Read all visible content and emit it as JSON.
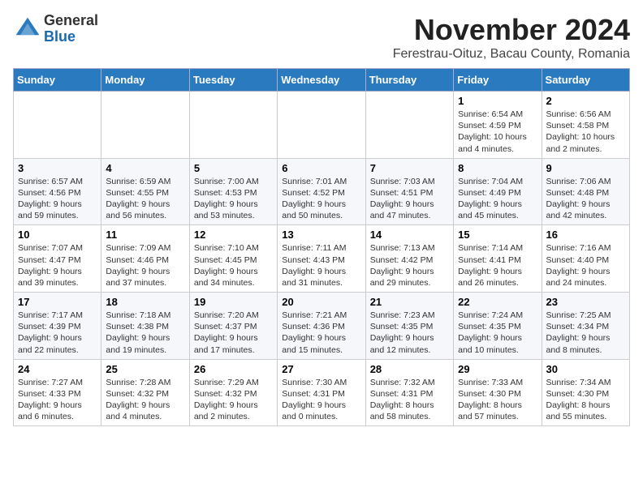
{
  "header": {
    "logo_general": "General",
    "logo_blue": "Blue",
    "month_title": "November 2024",
    "subtitle": "Ferestrau-Oituz, Bacau County, Romania"
  },
  "days_of_week": [
    "Sunday",
    "Monday",
    "Tuesday",
    "Wednesday",
    "Thursday",
    "Friday",
    "Saturday"
  ],
  "weeks": [
    [
      {
        "day": "",
        "info": ""
      },
      {
        "day": "",
        "info": ""
      },
      {
        "day": "",
        "info": ""
      },
      {
        "day": "",
        "info": ""
      },
      {
        "day": "",
        "info": ""
      },
      {
        "day": "1",
        "info": "Sunrise: 6:54 AM\nSunset: 4:59 PM\nDaylight: 10 hours and 4 minutes."
      },
      {
        "day": "2",
        "info": "Sunrise: 6:56 AM\nSunset: 4:58 PM\nDaylight: 10 hours and 2 minutes."
      }
    ],
    [
      {
        "day": "3",
        "info": "Sunrise: 6:57 AM\nSunset: 4:56 PM\nDaylight: 9 hours and 59 minutes."
      },
      {
        "day": "4",
        "info": "Sunrise: 6:59 AM\nSunset: 4:55 PM\nDaylight: 9 hours and 56 minutes."
      },
      {
        "day": "5",
        "info": "Sunrise: 7:00 AM\nSunset: 4:53 PM\nDaylight: 9 hours and 53 minutes."
      },
      {
        "day": "6",
        "info": "Sunrise: 7:01 AM\nSunset: 4:52 PM\nDaylight: 9 hours and 50 minutes."
      },
      {
        "day": "7",
        "info": "Sunrise: 7:03 AM\nSunset: 4:51 PM\nDaylight: 9 hours and 47 minutes."
      },
      {
        "day": "8",
        "info": "Sunrise: 7:04 AM\nSunset: 4:49 PM\nDaylight: 9 hours and 45 minutes."
      },
      {
        "day": "9",
        "info": "Sunrise: 7:06 AM\nSunset: 4:48 PM\nDaylight: 9 hours and 42 minutes."
      }
    ],
    [
      {
        "day": "10",
        "info": "Sunrise: 7:07 AM\nSunset: 4:47 PM\nDaylight: 9 hours and 39 minutes."
      },
      {
        "day": "11",
        "info": "Sunrise: 7:09 AM\nSunset: 4:46 PM\nDaylight: 9 hours and 37 minutes."
      },
      {
        "day": "12",
        "info": "Sunrise: 7:10 AM\nSunset: 4:45 PM\nDaylight: 9 hours and 34 minutes."
      },
      {
        "day": "13",
        "info": "Sunrise: 7:11 AM\nSunset: 4:43 PM\nDaylight: 9 hours and 31 minutes."
      },
      {
        "day": "14",
        "info": "Sunrise: 7:13 AM\nSunset: 4:42 PM\nDaylight: 9 hours and 29 minutes."
      },
      {
        "day": "15",
        "info": "Sunrise: 7:14 AM\nSunset: 4:41 PM\nDaylight: 9 hours and 26 minutes."
      },
      {
        "day": "16",
        "info": "Sunrise: 7:16 AM\nSunset: 4:40 PM\nDaylight: 9 hours and 24 minutes."
      }
    ],
    [
      {
        "day": "17",
        "info": "Sunrise: 7:17 AM\nSunset: 4:39 PM\nDaylight: 9 hours and 22 minutes."
      },
      {
        "day": "18",
        "info": "Sunrise: 7:18 AM\nSunset: 4:38 PM\nDaylight: 9 hours and 19 minutes."
      },
      {
        "day": "19",
        "info": "Sunrise: 7:20 AM\nSunset: 4:37 PM\nDaylight: 9 hours and 17 minutes."
      },
      {
        "day": "20",
        "info": "Sunrise: 7:21 AM\nSunset: 4:36 PM\nDaylight: 9 hours and 15 minutes."
      },
      {
        "day": "21",
        "info": "Sunrise: 7:23 AM\nSunset: 4:35 PM\nDaylight: 9 hours and 12 minutes."
      },
      {
        "day": "22",
        "info": "Sunrise: 7:24 AM\nSunset: 4:35 PM\nDaylight: 9 hours and 10 minutes."
      },
      {
        "day": "23",
        "info": "Sunrise: 7:25 AM\nSunset: 4:34 PM\nDaylight: 9 hours and 8 minutes."
      }
    ],
    [
      {
        "day": "24",
        "info": "Sunrise: 7:27 AM\nSunset: 4:33 PM\nDaylight: 9 hours and 6 minutes."
      },
      {
        "day": "25",
        "info": "Sunrise: 7:28 AM\nSunset: 4:32 PM\nDaylight: 9 hours and 4 minutes."
      },
      {
        "day": "26",
        "info": "Sunrise: 7:29 AM\nSunset: 4:32 PM\nDaylight: 9 hours and 2 minutes."
      },
      {
        "day": "27",
        "info": "Sunrise: 7:30 AM\nSunset: 4:31 PM\nDaylight: 9 hours and 0 minutes."
      },
      {
        "day": "28",
        "info": "Sunrise: 7:32 AM\nSunset: 4:31 PM\nDaylight: 8 hours and 58 minutes."
      },
      {
        "day": "29",
        "info": "Sunrise: 7:33 AM\nSunset: 4:30 PM\nDaylight: 8 hours and 57 minutes."
      },
      {
        "day": "30",
        "info": "Sunrise: 7:34 AM\nSunset: 4:30 PM\nDaylight: 8 hours and 55 minutes."
      }
    ]
  ]
}
